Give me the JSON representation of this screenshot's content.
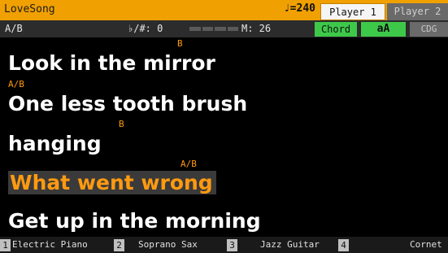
{
  "header": {
    "song_title": "LoveSong",
    "tempo": "♩=240",
    "player1": "Player 1",
    "player2": "Player 2"
  },
  "info": {
    "chord": "A/B",
    "key": "♭/#: 0",
    "measure": "M: 26",
    "chord_button": "Chord",
    "font_button": "aA",
    "cdg_button": "CDG"
  },
  "lyrics": [
    {
      "chord": "B",
      "text": "Look in the mirror"
    },
    {
      "chord": "A/B",
      "text": "One less tooth brush"
    },
    {
      "chord": "B",
      "text": "hanging"
    },
    {
      "chord": "A/B",
      "text": "What went wrong"
    },
    {
      "chord": "",
      "text": "Get up in the morning"
    }
  ],
  "tracks": [
    {
      "num": "1",
      "name": "Electric Piano"
    },
    {
      "num": "2",
      "name": "Soprano Sax"
    },
    {
      "num": "3",
      "name": "Jazz Guitar"
    },
    {
      "num": "4",
      "name": "Cornet"
    }
  ],
  "colors": {
    "accent": "#f0a000",
    "highlight": "#ff9a10",
    "active_button": "#3ec84a"
  }
}
